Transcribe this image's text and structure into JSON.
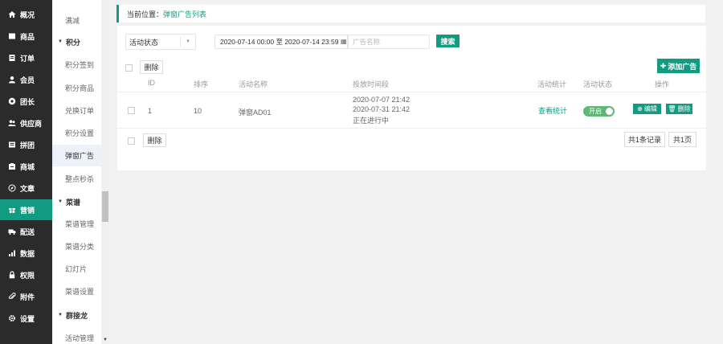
{
  "nav": {
    "items": [
      {
        "label": "概况",
        "icon": "home-icon"
      },
      {
        "label": "商品",
        "icon": "goods-icon"
      },
      {
        "label": "订单",
        "icon": "order-icon"
      },
      {
        "label": "会员",
        "icon": "user-icon"
      },
      {
        "label": "团长",
        "icon": "leader-icon"
      },
      {
        "label": "供应商",
        "icon": "supplier-icon"
      },
      {
        "label": "拼团",
        "icon": "group-icon"
      },
      {
        "label": "商城",
        "icon": "mall-icon"
      },
      {
        "label": "文章",
        "icon": "compass-icon"
      },
      {
        "label": "营销",
        "icon": "gift-icon"
      },
      {
        "label": "配送",
        "icon": "truck-icon"
      },
      {
        "label": "数据",
        "icon": "chart-icon"
      },
      {
        "label": "权限",
        "icon": "lock-icon"
      },
      {
        "label": "附件",
        "icon": "paperclip-icon"
      },
      {
        "label": "设置",
        "icon": "gear-icon"
      }
    ],
    "active_index": 9,
    "active_color": "#119b80"
  },
  "subnav": {
    "items": [
      {
        "type": "item",
        "label": "满减"
      },
      {
        "type": "group",
        "label": "积分"
      },
      {
        "type": "item",
        "label": "积分签到"
      },
      {
        "type": "item",
        "label": "积分商品"
      },
      {
        "type": "item",
        "label": "兑换订单"
      },
      {
        "type": "item",
        "label": "积分设置"
      },
      {
        "type": "item",
        "label": "弹窗广告",
        "active": true
      },
      {
        "type": "item",
        "label": "整点秒杀"
      },
      {
        "type": "group",
        "label": "菜谱"
      },
      {
        "type": "item",
        "label": "菜谱管理"
      },
      {
        "type": "item",
        "label": "菜谱分类"
      },
      {
        "type": "item",
        "label": "幻灯片"
      },
      {
        "type": "item",
        "label": "菜谱设置"
      },
      {
        "type": "group",
        "label": "群接龙"
      },
      {
        "type": "item",
        "label": "活动管理"
      }
    ]
  },
  "breadcrumb": {
    "prefix": "当前位置：",
    "current": "弹窗广告列表"
  },
  "filters": {
    "status_select": "活动状态",
    "date_range": "2020-07-14 00:00 至 2020-07-14 23:59",
    "ad_name_placeholder": "广告名称",
    "search_label": "搜索"
  },
  "toolbar": {
    "delete_label": "删除",
    "add_label": "添加广告"
  },
  "table": {
    "headers": [
      "ID",
      "排序",
      "活动名称",
      "投放时间段",
      "活动统计",
      "活动状态",
      "操作"
    ],
    "rows": [
      {
        "id": "1",
        "sort": "10",
        "name": "弹窗AD01",
        "time_start": "2020-07-07 21:42",
        "time_end": "2020-07-31 21:42",
        "time_status": "正在进行中",
        "stats_link": "查看统计",
        "status_toggle": "开启",
        "edit_label": "编辑",
        "delete_label": "删除"
      }
    ]
  },
  "footer": {
    "delete_label": "删除",
    "total_records": "共1条记录",
    "total_pages": "共1页"
  }
}
